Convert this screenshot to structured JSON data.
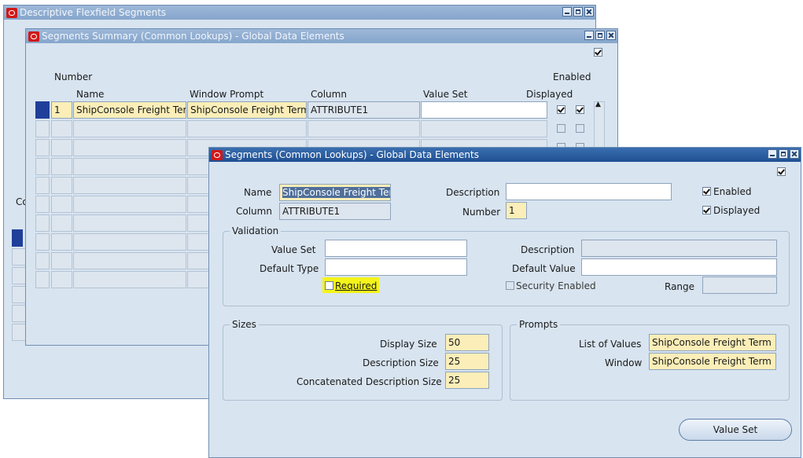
{
  "windows": {
    "descriptive": {
      "title": "Descriptive Flexfield Segments",
      "partial_label": "Co"
    },
    "summary": {
      "title": "Segments Summary (Common Lookups) - Global Data Elements",
      "headers": {
        "number": "Number",
        "name": "Name",
        "window_prompt": "Window Prompt",
        "column": "Column",
        "value_set": "Value Set",
        "enabled": "Enabled",
        "displayed": "Displayed"
      },
      "row1": {
        "number": "1",
        "name": "ShipConsole Freight Ter",
        "window_prompt": "ShipConsole Freight Term",
        "column": "ATTRIBUTE1",
        "value_set": "",
        "displayed": true,
        "enabled": true
      }
    },
    "segments": {
      "title": "Segments (Common Lookups) - Global Data Elements",
      "labels": {
        "name": "Name",
        "column": "Column",
        "description": "Description",
        "number": "Number",
        "enabled": "Enabled",
        "displayed": "Displayed"
      },
      "values": {
        "name": "ShipConsole Freight Ter",
        "column": "ATTRIBUTE1",
        "description": "",
        "number": "1",
        "enabled": true,
        "displayed": true
      },
      "validation": {
        "title": "Validation",
        "value_set_label": "Value Set",
        "value_set": "",
        "default_type_label": "Default Type",
        "default_type": "",
        "required_label": "Required",
        "required": false,
        "description_label": "Description",
        "description": "",
        "default_value_label": "Default Value",
        "default_value": "",
        "security_label": "Security Enabled",
        "security": false,
        "range_label": "Range",
        "range": ""
      },
      "sizes": {
        "title": "Sizes",
        "display_label": "Display Size",
        "display": "50",
        "description_label": "Description Size",
        "description": "25",
        "concat_label": "Concatenated Description Size",
        "concat": "25"
      },
      "prompts": {
        "title": "Prompts",
        "lov_label": "List of Values",
        "lov": "ShipConsole Freight Term",
        "window_label": "Window",
        "window": "ShipConsole Freight Term"
      },
      "value_set_button": "Value Set"
    }
  },
  "colors": {
    "active_title": "#1f4f92",
    "highlight": "#f4f41a",
    "required_field": "#fbeeb8"
  }
}
